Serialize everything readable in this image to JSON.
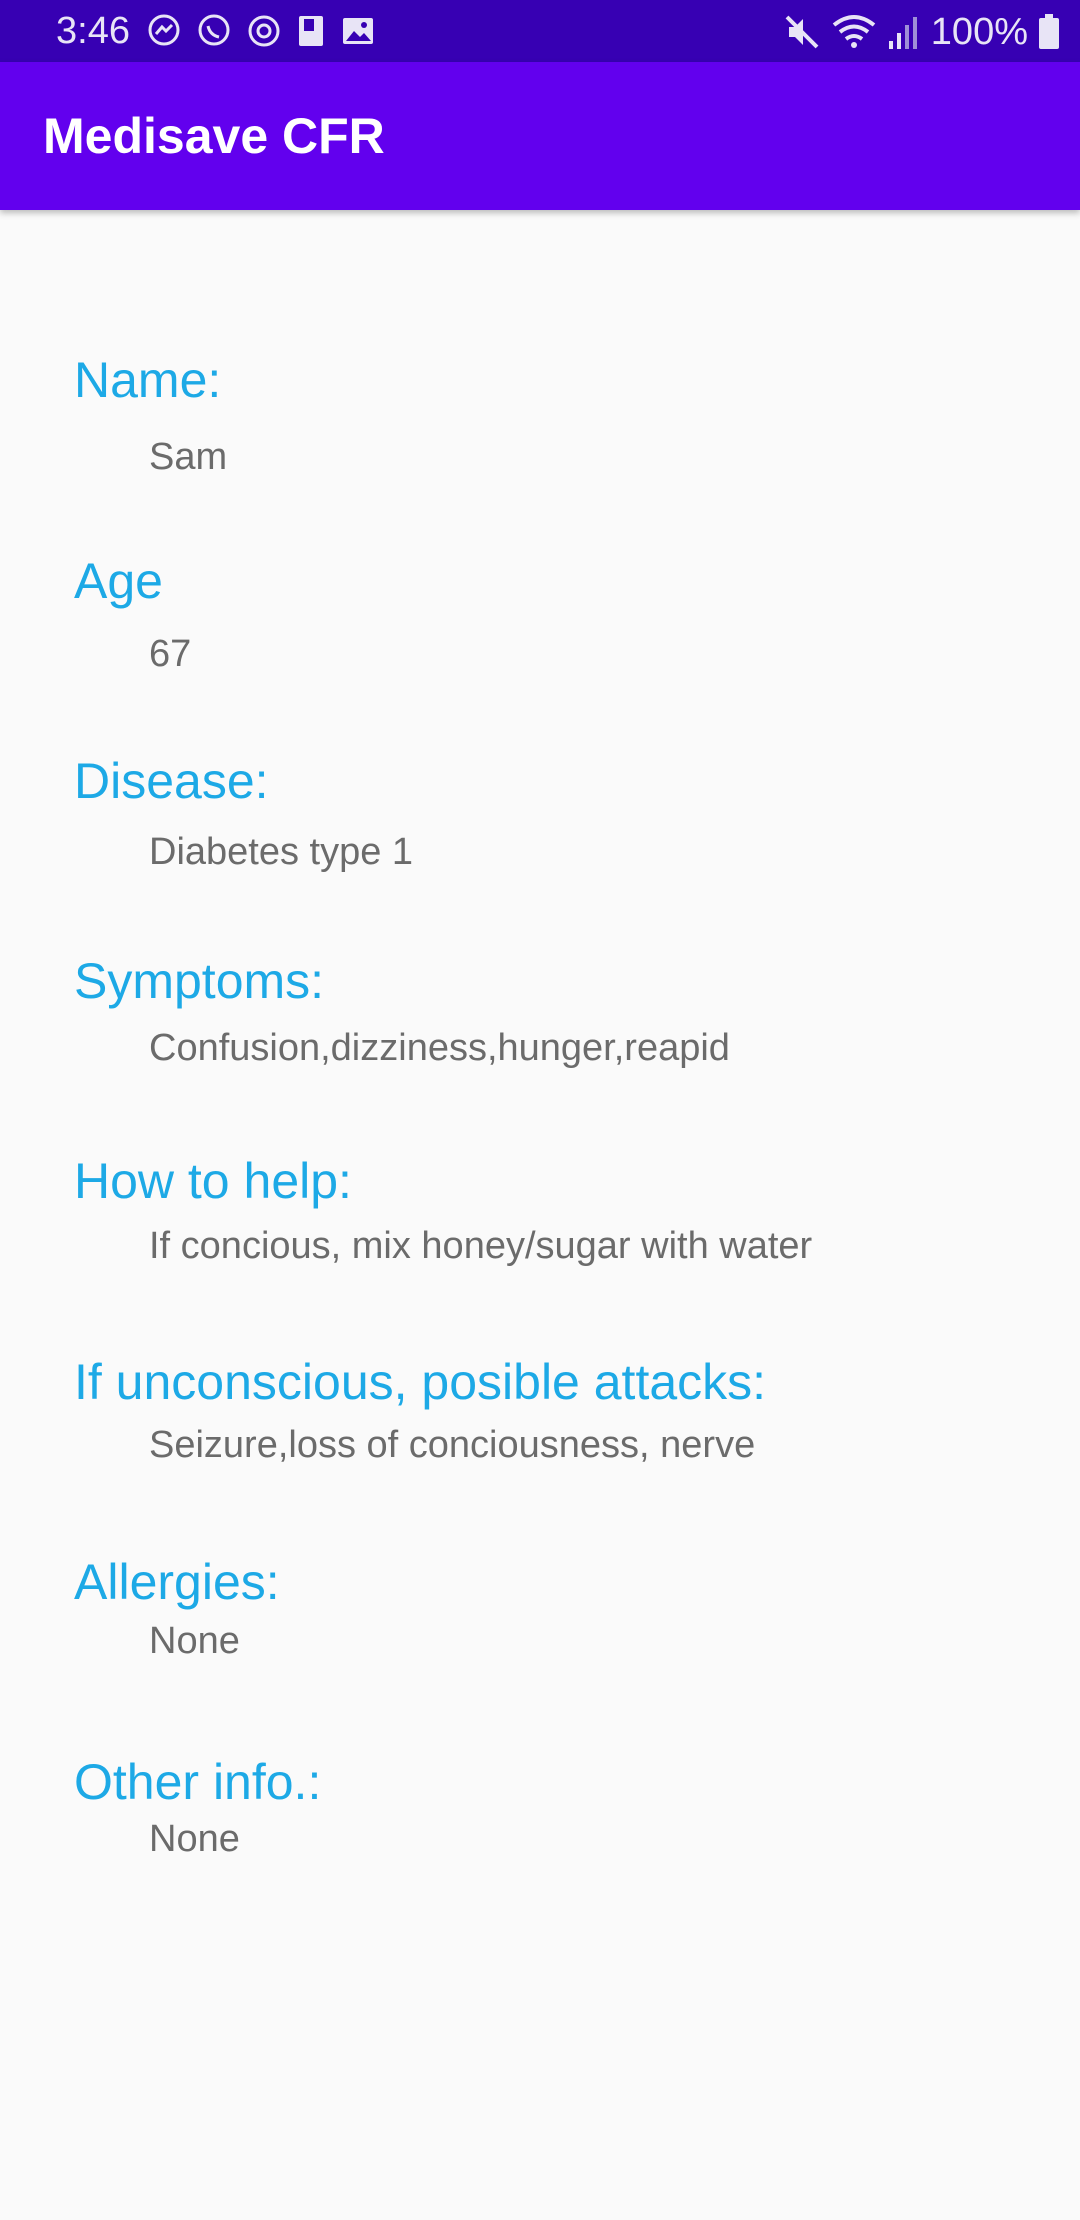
{
  "status_bar": {
    "time": "3:46",
    "battery": "100%",
    "left_icons": [
      "messenger-icon",
      "whatsapp-icon",
      "sync-icon",
      "book-icon",
      "image-icon"
    ],
    "right_icons": [
      "mute-icon",
      "wifi-icon",
      "signal-icon",
      "battery-icon"
    ]
  },
  "app_bar": {
    "title": "Medisave CFR"
  },
  "fields": [
    {
      "label": "Name:",
      "value": "Sam"
    },
    {
      "label": "Age",
      "value": "67"
    },
    {
      "label": "Disease:",
      "value": "Diabetes type 1"
    },
    {
      "label": "Symptoms:",
      "value": "Confusion,dizziness,hunger,reapid breathe..."
    },
    {
      "label": "How to help:",
      "value": "If concious, mix honey/sugar with water and give. If unconscious, seize..."
    },
    {
      "label": "If unconscious, posible attacks:",
      "value": "Seizure,loss of conciousness, nerve damage"
    },
    {
      "label": "Allergies:",
      "value": "None"
    },
    {
      "label": "Other info.:",
      "value": "None"
    }
  ],
  "colors": {
    "status_bar": "#3700b3",
    "app_bar": "#6200ee",
    "label": "#1da9e6",
    "value": "#6b6b6b",
    "background": "#fafafa"
  }
}
